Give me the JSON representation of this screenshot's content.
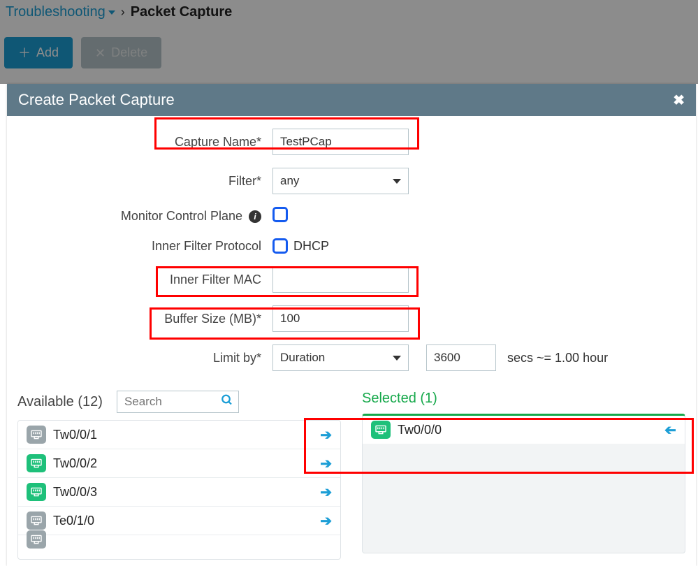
{
  "breadcrumb": {
    "parent": "Troubleshooting",
    "separator": "›",
    "current": "Packet Capture"
  },
  "toolbar": {
    "add_label": "Add",
    "delete_label": "Delete"
  },
  "modal": {
    "title": "Create Packet Capture",
    "close_glyph": "✖",
    "form": {
      "capture_name": {
        "label": "Capture Name*",
        "value": "TestPCap"
      },
      "filter": {
        "label": "Filter*",
        "value": "any"
      },
      "mcp": {
        "label": "Monitor Control Plane",
        "checked": false
      },
      "ifp": {
        "label": "Inner Filter Protocol",
        "option": "DHCP",
        "checked": false
      },
      "ifmac": {
        "label": "Inner Filter MAC",
        "value": ""
      },
      "buffer": {
        "label": "Buffer Size (MB)*",
        "value": "100"
      },
      "limit": {
        "label": "Limit by*",
        "mode": "Duration",
        "value": "3600",
        "hint": "secs ~= 1.00 hour"
      }
    },
    "available": {
      "title": "Available (12)",
      "search_placeholder": "Search",
      "items": [
        {
          "label": "Tw0/0/1",
          "color": "grey"
        },
        {
          "label": "Tw0/0/2",
          "color": "green"
        },
        {
          "label": "Tw0/0/3",
          "color": "green"
        },
        {
          "label": "Te0/1/0",
          "color": "grey"
        }
      ]
    },
    "selected": {
      "title": "Selected (1)",
      "items": [
        {
          "label": "Tw0/0/0",
          "color": "green"
        }
      ]
    }
  }
}
